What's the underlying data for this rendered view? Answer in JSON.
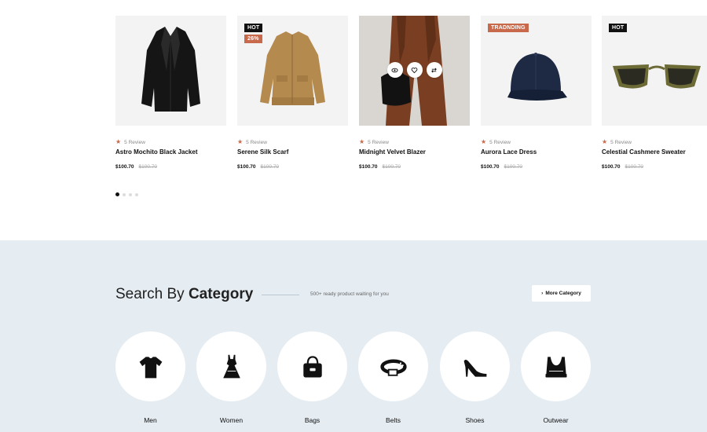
{
  "products": [
    {
      "name": "Astro Mochito Black Jacket",
      "review": "5 Review",
      "price": "$100.70",
      "old_price": "$100.70",
      "badges": [],
      "image_icon": "black-blazer-image"
    },
    {
      "name": "Serene Silk Scarf",
      "review": "5 Review",
      "price": "$100.70",
      "old_price": "$100.70",
      "badges": [
        "HOT",
        "26%"
      ],
      "image_icon": "tan-bomber-jacket-image"
    },
    {
      "name": "Midnight Velvet Blazer",
      "review": "5 Review",
      "price": "$100.70",
      "old_price": "$100.70",
      "badges": [],
      "image_icon": "model-brown-pants-bag-image"
    },
    {
      "name": "Aurora Lace Dress",
      "review": "5 Review",
      "price": "$100.70",
      "old_price": "$100.70",
      "badges": [
        "TRADNDING"
      ],
      "image_icon": "navy-cap-image"
    },
    {
      "name": "Celestial Cashmere Sweater",
      "review": "5 Review",
      "price": "$100.70",
      "old_price": "$100.70",
      "badges": [
        "HOT"
      ],
      "image_icon": "sunglasses-image"
    }
  ],
  "carousel": {
    "pages": 4,
    "active": 0
  },
  "category_section": {
    "title_light": "Search By",
    "title_bold": "Category",
    "subtitle": "500+ ready product waiting for you",
    "more_button": "More Category",
    "more_button_icon": "chevron-right-icon",
    "items": [
      {
        "label": "Men",
        "icon": "tshirt-icon"
      },
      {
        "label": "Women",
        "icon": "dress-icon"
      },
      {
        "label": "Bags",
        "icon": "handbag-icon"
      },
      {
        "label": "Belts",
        "icon": "belt-icon"
      },
      {
        "label": "Shoes",
        "icon": "high-heel-icon"
      },
      {
        "label": "Outwear",
        "icon": "top-icon"
      }
    ]
  },
  "colors": {
    "accent": "#c9694b",
    "section_bg": "#e5edf3",
    "badge_dark": "#111111"
  }
}
